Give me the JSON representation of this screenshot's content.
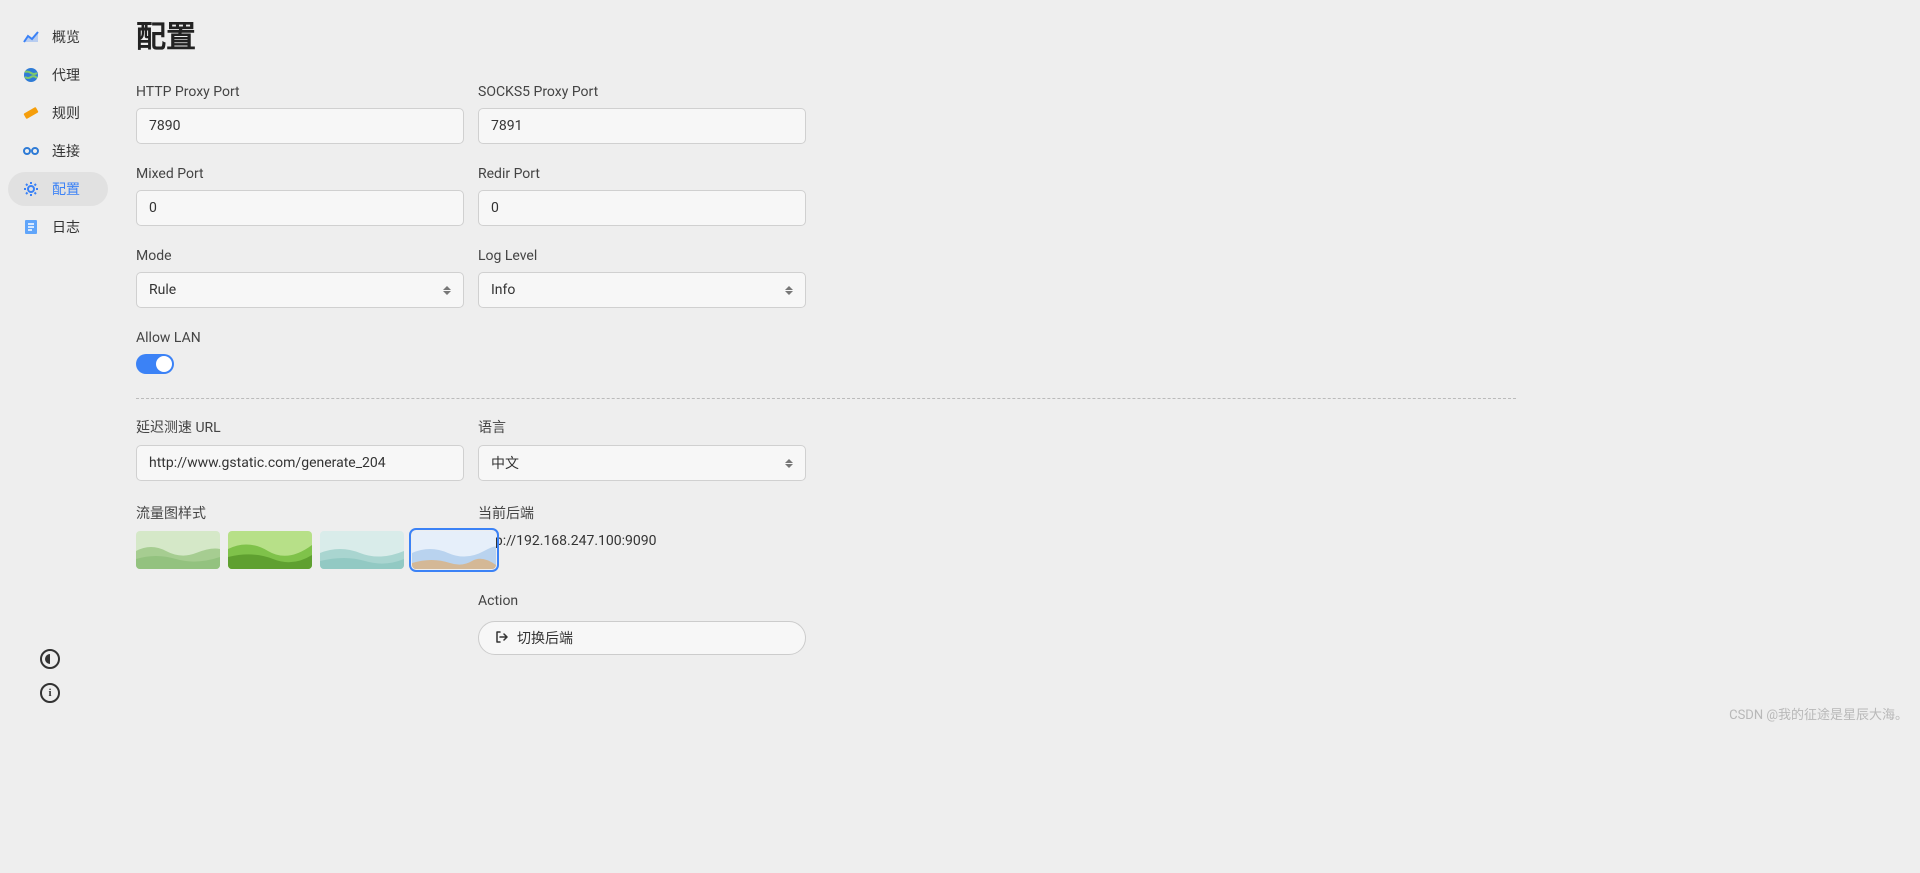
{
  "sidebar": {
    "items": [
      {
        "label": "概览",
        "icon": "chart-icon"
      },
      {
        "label": "代理",
        "icon": "globe-icon"
      },
      {
        "label": "规则",
        "icon": "ruler-icon"
      },
      {
        "label": "连接",
        "icon": "link-icon"
      },
      {
        "label": "配置",
        "icon": "gear-icon"
      },
      {
        "label": "日志",
        "icon": "log-icon"
      }
    ]
  },
  "page": {
    "title": "配置"
  },
  "fields": {
    "http_port": {
      "label": "HTTP Proxy Port",
      "value": "7890"
    },
    "socks_port": {
      "label": "SOCKS5 Proxy Port",
      "value": "7891"
    },
    "mixed_port": {
      "label": "Mixed Port",
      "value": "0"
    },
    "redir_port": {
      "label": "Redir Port",
      "value": "0"
    },
    "mode": {
      "label": "Mode",
      "value": "Rule"
    },
    "log_level": {
      "label": "Log Level",
      "value": "Info"
    },
    "allow_lan": {
      "label": "Allow LAN",
      "value": true
    },
    "latency_url": {
      "label": "延迟测速 URL",
      "value": "http://www.gstatic.com/generate_204"
    },
    "language": {
      "label": "语言",
      "value": "中文"
    },
    "chart_style": {
      "label": "流量图样式"
    },
    "backend": {
      "label": "当前后端",
      "value": "http://192.168.247.100:9090"
    },
    "action": {
      "label": "Action",
      "button": "切换后端"
    }
  },
  "watermark": "CSDN @我的征途是星辰大海。"
}
